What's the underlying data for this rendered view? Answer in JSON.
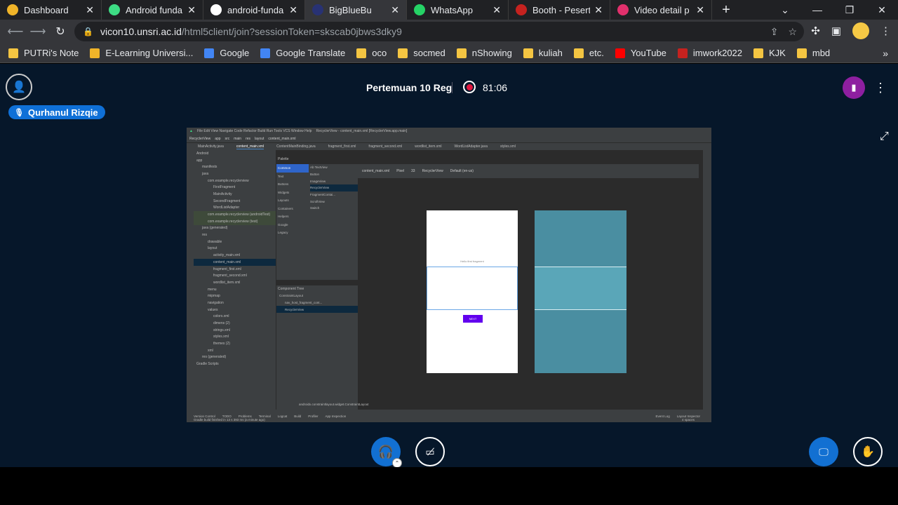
{
  "browser": {
    "tabs": [
      {
        "title": "Dashboard",
        "favicon": "moodle-icon",
        "color": "#f0b429",
        "active": false
      },
      {
        "title": "Android funda",
        "favicon": "android-icon",
        "color": "#3ddc84",
        "active": false
      },
      {
        "title": "android-funda",
        "favicon": "github-icon",
        "color": "#ffffff",
        "active": false
      },
      {
        "title": "BigBlueBu",
        "favicon": "bigbluebutton-icon",
        "color": "#283274",
        "active": true
      },
      {
        "title": "WhatsApp",
        "favicon": "whatsapp-icon",
        "color": "#25d366",
        "active": false
      },
      {
        "title": "Booth - Pesert",
        "favicon": "gmail-icon",
        "color": "#c5221f",
        "active": false
      },
      {
        "title": "Video detail p",
        "favicon": "instagram-icon",
        "color": "#e1306c",
        "active": false
      }
    ],
    "address": {
      "host": "vicon10.unsri.ac.id",
      "path": "/html5client/join?sessionToken=skscab0jbws3dky9"
    },
    "bookmarks": [
      {
        "label": "PUTRi's Note",
        "icon": "notes-icon",
        "color": "#f4c542"
      },
      {
        "label": "E-Learning Universi...",
        "icon": "moodle-icon",
        "color": "#f0b429"
      },
      {
        "label": "Google",
        "icon": "google-icon",
        "color": "#4285f4"
      },
      {
        "label": "Google Translate",
        "icon": "translate-icon",
        "color": "#4285f4"
      },
      {
        "label": "oco",
        "icon": "folder-icon",
        "color": "#f4c542"
      },
      {
        "label": "socmed",
        "icon": "folder-icon",
        "color": "#f4c542"
      },
      {
        "label": "nShowing",
        "icon": "folder-icon",
        "color": "#f4c542"
      },
      {
        "label": "kuliah",
        "icon": "folder-icon",
        "color": "#f4c542"
      },
      {
        "label": "etc.",
        "icon": "folder-icon",
        "color": "#f4c542"
      },
      {
        "label": "YouTube",
        "icon": "youtube-icon",
        "color": "#ff0000"
      },
      {
        "label": "imwork2022",
        "icon": "gmail-icon",
        "color": "#c5221f"
      },
      {
        "label": "KJK",
        "icon": "folder-icon",
        "color": "#f4c542"
      },
      {
        "label": "mbd",
        "icon": "folder-icon",
        "color": "#f4c542"
      }
    ],
    "more_bookmarks": "»"
  },
  "meeting": {
    "title": "Pertemuan 10 Reg",
    "record_time": "81:06",
    "talker": "Qurhanul Rizqie"
  },
  "shared_screen": {
    "window_title": "RecyclerView - content_main.xml [RecyclerView.app.main]",
    "breadcrumb": [
      "RecyclerView",
      "app",
      "src",
      "main",
      "res",
      "layout",
      "content_main.xml"
    ],
    "editor_tabs": [
      "MainActivity.java",
      "content_main.xml",
      "ContentMainBinding.java",
      "fragment_first.xml",
      "fragment_second.xml",
      "wordlist_item.xml",
      "WordListAdapter.java",
      "styles.xml"
    ],
    "project_tree": [
      {
        "label": "app",
        "depth": 0
      },
      {
        "label": "manifests",
        "depth": 1
      },
      {
        "label": "java",
        "depth": 1
      },
      {
        "label": "com.example.recyclerview",
        "depth": 2
      },
      {
        "label": "FirstFragment",
        "depth": 3
      },
      {
        "label": "MainActivity",
        "depth": 3
      },
      {
        "label": "SecondFragment",
        "depth": 3
      },
      {
        "label": "WordListAdapter",
        "depth": 3
      },
      {
        "label": "com.example.recyclerview (androidTest)",
        "depth": 2,
        "highlight": true
      },
      {
        "label": "com.example.recyclerview (test)",
        "depth": 2,
        "highlight": true
      },
      {
        "label": "java (generated)",
        "depth": 1
      },
      {
        "label": "res",
        "depth": 1
      },
      {
        "label": "drawable",
        "depth": 2
      },
      {
        "label": "layout",
        "depth": 2
      },
      {
        "label": "activity_main.xml",
        "depth": 3
      },
      {
        "label": "content_main.xml",
        "depth": 3,
        "selected": true
      },
      {
        "label": "fragment_first.xml",
        "depth": 3
      },
      {
        "label": "fragment_second.xml",
        "depth": 3
      },
      {
        "label": "wordlist_item.xml",
        "depth": 3
      },
      {
        "label": "menu",
        "depth": 2
      },
      {
        "label": "mipmap",
        "depth": 2
      },
      {
        "label": "navigation",
        "depth": 2
      },
      {
        "label": "values",
        "depth": 2
      },
      {
        "label": "colors.xml",
        "depth": 3
      },
      {
        "label": "dimens (2)",
        "depth": 3
      },
      {
        "label": "strings.xml",
        "depth": 3
      },
      {
        "label": "styles.xml",
        "depth": 3
      },
      {
        "label": "themes (2)",
        "depth": 3
      },
      {
        "label": "xml",
        "depth": 2
      },
      {
        "label": "res (generated)",
        "depth": 1
      },
      {
        "label": "Gradle Scripts",
        "depth": 0
      }
    ],
    "palette_title": "Palette",
    "palette_categories": [
      "Common",
      "Text",
      "Buttons",
      "Widgets",
      "Layouts",
      "Containers",
      "Helpers",
      "Google",
      "Legacy"
    ],
    "palette_items": [
      "Ab TextView",
      "Button",
      "ImageView",
      "RecyclerView",
      "FragmentContai...",
      "ScrollView",
      "Switch"
    ],
    "component_tree_title": "Component Tree",
    "component_tree": [
      "ConstraintLayout",
      "nav_host_fragment_cont...",
      "RecyclerView"
    ],
    "design_toolbar": {
      "file": "content_main.xml",
      "api": "33",
      "component": "RecyclerView",
      "theme": "Default (en-us)",
      "device": "Pixel"
    },
    "preview": {
      "header_text": "Hello first fragment",
      "next_button": "NEXT"
    },
    "status_path": "androidx.constraintlayout.widget.ConstraintLayout",
    "bottom_tabs": [
      "Version Control",
      "TODO",
      "Problems",
      "Terminal",
      "Logcat",
      "Build",
      "Profiler",
      "App Inspection"
    ],
    "bottom_right_tabs": [
      "Event Log",
      "Layout Inspector"
    ],
    "status_message": "Gradle build finished in 13 s 393 ms (a minute ago)",
    "status_right": "4 spaces"
  }
}
